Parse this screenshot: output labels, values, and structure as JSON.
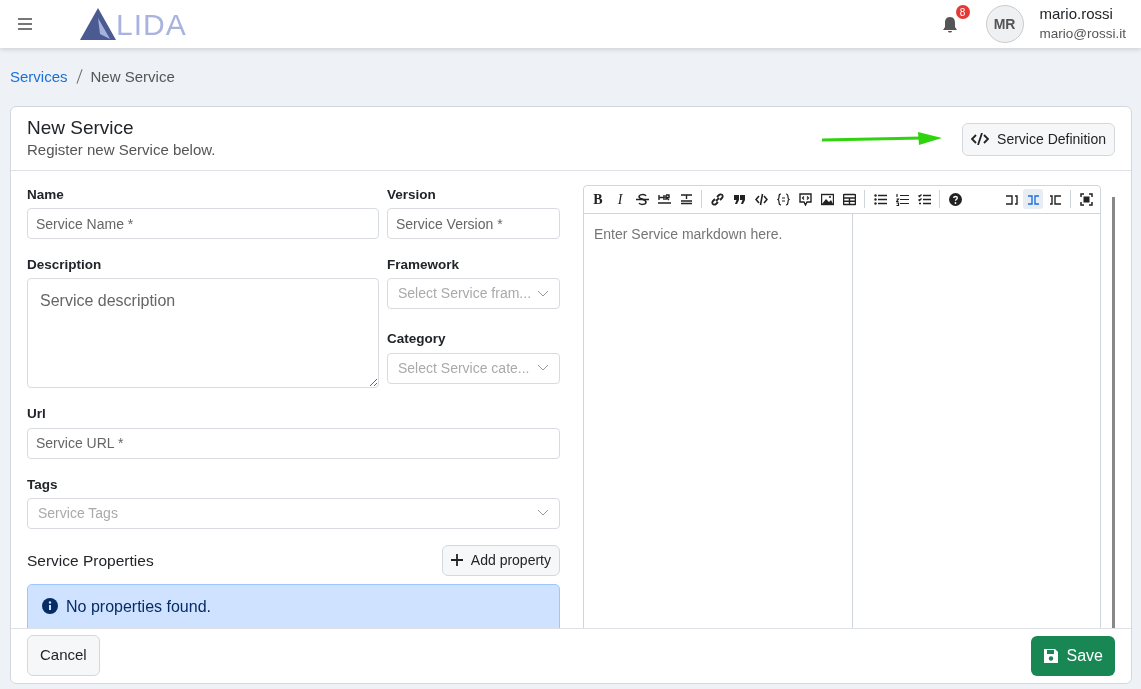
{
  "navbar": {
    "logo_text": "LIDA",
    "notification_count": "8",
    "user": {
      "initials": "MR",
      "username": "mario.rossi",
      "email": "mario@rossi.it"
    }
  },
  "breadcrumb": [
    {
      "label": "Services",
      "link": true
    },
    {
      "label": "New Service",
      "link": false
    }
  ],
  "card": {
    "title": "New Service",
    "subtitle": "Register new Service below.",
    "definition_button": "Service Definition"
  },
  "form": {
    "name": {
      "label": "Name",
      "placeholder": "Service Name *"
    },
    "version": {
      "label": "Version",
      "placeholder": "Service Version *"
    },
    "description": {
      "label": "Description",
      "placeholder": "Service description"
    },
    "framework": {
      "label": "Framework",
      "placeholder": "Select Service fram..."
    },
    "category": {
      "label": "Category",
      "placeholder": "Select Service cate..."
    },
    "url": {
      "label": "Url",
      "placeholder": "Service URL *"
    },
    "tags": {
      "label": "Tags",
      "placeholder": "Service Tags"
    },
    "properties_title": "Service Properties",
    "add_property": "Add property",
    "empty_message": "No properties found."
  },
  "editor": {
    "placeholder": "Enter Service markdown here.",
    "toolbar": [
      {
        "kind": "bold",
        "glyph": "B"
      },
      {
        "kind": "italic",
        "glyph": "I"
      },
      {
        "kind": "strike"
      },
      {
        "kind": "hr"
      },
      {
        "kind": "title"
      },
      {
        "kind": "sep"
      },
      {
        "kind": "link"
      },
      {
        "kind": "quote"
      },
      {
        "kind": "code"
      },
      {
        "kind": "codeblock"
      },
      {
        "kind": "comment"
      },
      {
        "kind": "image"
      },
      {
        "kind": "table"
      },
      {
        "kind": "sep"
      },
      {
        "kind": "ul"
      },
      {
        "kind": "ol"
      },
      {
        "kind": "checklist"
      },
      {
        "kind": "sep"
      },
      {
        "kind": "help"
      }
    ],
    "modes": [
      {
        "kind": "edit",
        "selected": false
      },
      {
        "kind": "live",
        "selected": true
      },
      {
        "kind": "preview",
        "selected": false
      }
    ]
  },
  "footer": {
    "cancel": "Cancel",
    "save": "Save"
  }
}
